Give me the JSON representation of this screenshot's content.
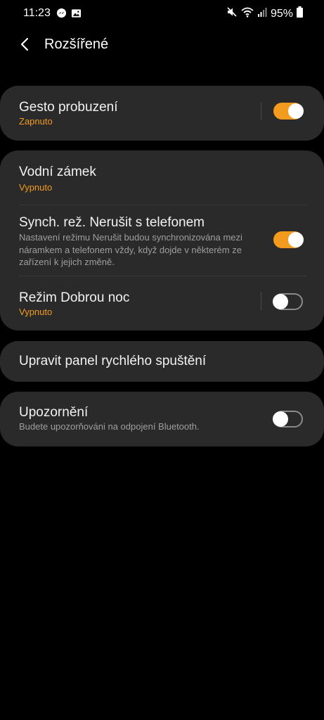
{
  "status_bar": {
    "time": "11:23",
    "battery": "95%",
    "left_icons": [
      "messenger-icon",
      "gallery-icon"
    ],
    "right_icons": [
      "mute-icon",
      "wifi-icon",
      "signal-icon",
      "battery-icon"
    ]
  },
  "header": {
    "title": "Rozšířené",
    "back_icon": "back-arrow-icon"
  },
  "settings": {
    "gesto": {
      "title": "Gesto probuzení",
      "status": "Zapnuto",
      "toggle": true
    },
    "vodni": {
      "title": "Vodní zámek",
      "status": "Vypnuto"
    },
    "synch": {
      "title": "Synch. rež. Nerušit s telefonem",
      "description": "Nastavení režimu Nerušit budou synchronizována mezi náramkem a telefonem vždy, když dojde v některém ze zařízení k jejich změně.",
      "toggle": true
    },
    "dobrou_noc": {
      "title": "Režim Dobrou noc",
      "status": "Vypnuto",
      "toggle": false
    },
    "panel": {
      "title": "Upravit panel rychlého spuštění"
    },
    "upozorneni": {
      "title": "Upozornění",
      "description": "Budete upozorňováni na odpojení Bluetooth.",
      "toggle": false
    }
  },
  "colors": {
    "accent": "#f39b1f",
    "card": "#2a2a2a",
    "background": "#000000",
    "secondary_text": "#9e9e9e"
  }
}
